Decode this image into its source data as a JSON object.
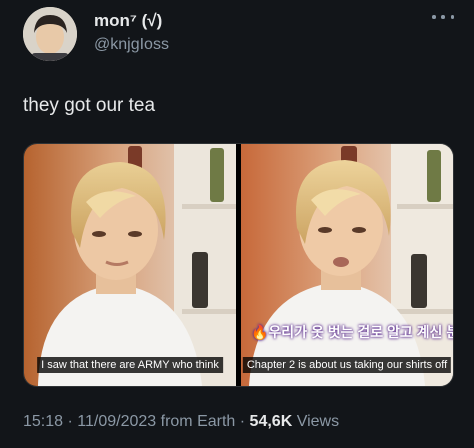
{
  "author": {
    "display_name": "mon⁷ (√)",
    "handle": "@knjgIoss",
    "avatar_icon": "profile-avatar"
  },
  "tweet": {
    "text": "they got our tea"
  },
  "media": [
    {
      "subtitle": "I saw that there are ARMY who think",
      "overlay_text": ""
    },
    {
      "subtitle": "Chapter 2 is about us taking our shirts off",
      "overlay_text": "🔥우리가 옷 벗는 걸로 알고 계신 분들이 !🔥"
    }
  ],
  "meta": {
    "time": "15:18",
    "date": "11/09/2023",
    "source": "from Earth",
    "views_count": "54,6K",
    "views_label": "Views"
  },
  "colors": {
    "background": "#121519",
    "text_primary": "#e7e9ea",
    "text_secondary": "#8b98a5"
  }
}
